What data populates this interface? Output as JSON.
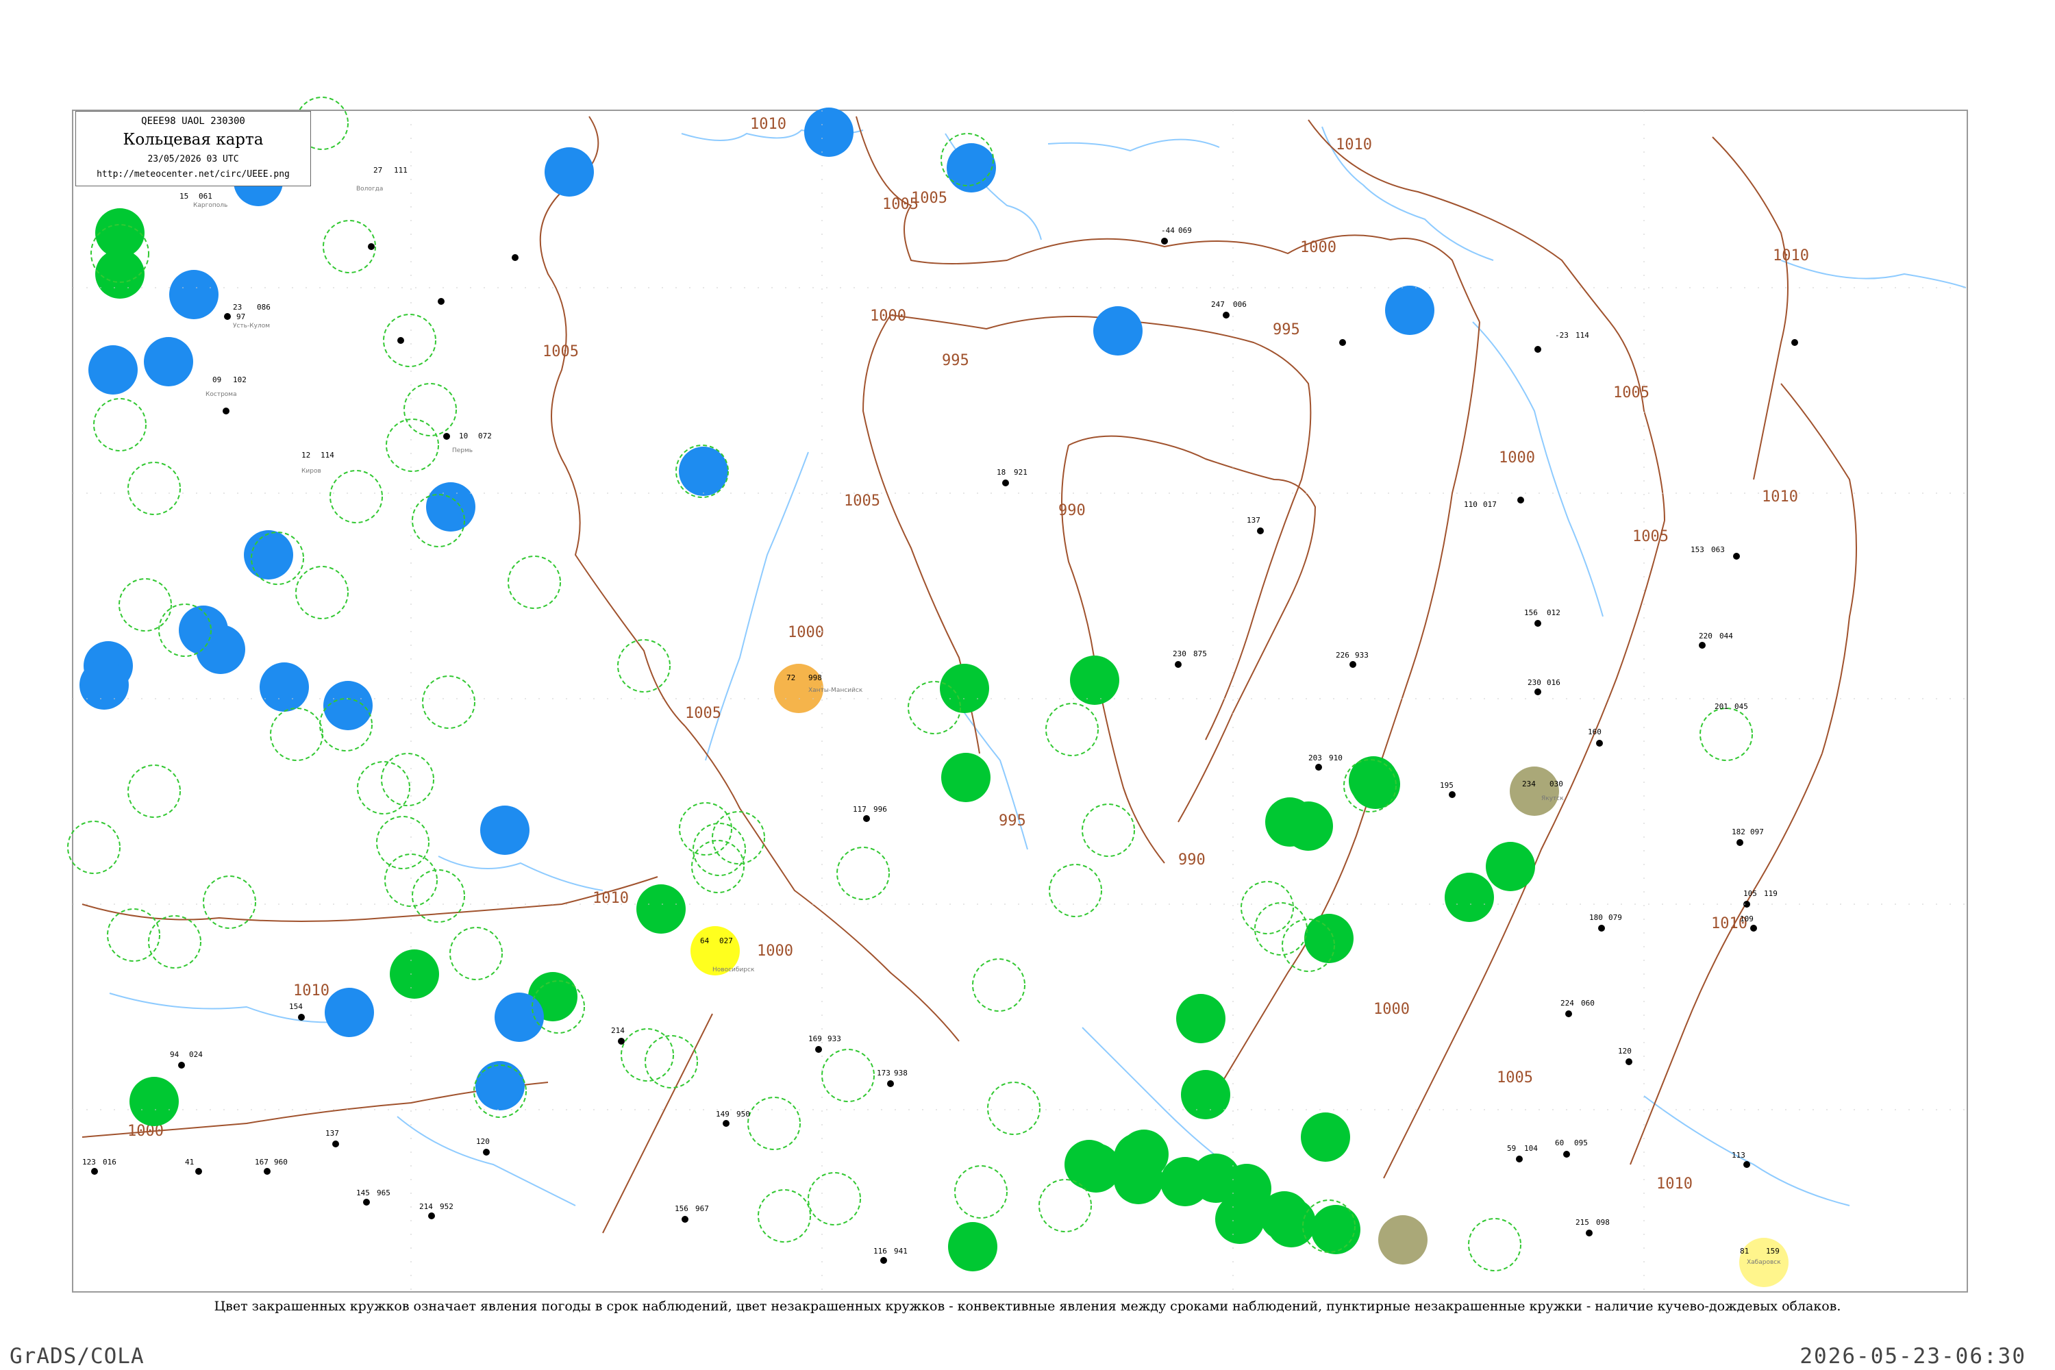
{
  "header": {
    "code": "QEEE98 UAOL 230300",
    "title": "Кольцевая карта",
    "datetime": "23/05/2026 03 UTC",
    "url": "http://meteocenter.net/circ/UEEE.png"
  },
  "caption": "Цвет закрашенных кружков означает явления погоды в срок наблюдений, цвет незакрашенных кружков - конвективные явления между сроками наблюдений, пунктирные незакрашенные кружки - наличие кучево-дождевых облаков.",
  "footer": {
    "software": "GrADS/COLA",
    "generated": "2026-05-23-06:30"
  },
  "colors": {
    "frame": "#9a9a9a",
    "isobar": "#a0522d",
    "isobar_label": "#a0522d",
    "water": "#8ecbff",
    "rain": "#00c832",
    "snow": "#1e8cf0",
    "fog_haze": "#f5b44b",
    "lightning": "#ffff1e",
    "dust": "#aaa878",
    "yellow_light": "#fff58c",
    "cb_dashed": "#32c832",
    "station_text": "#000000"
  },
  "isobar_labels": [
    "1010",
    "1005",
    "1000",
    "995",
    "990",
    "995",
    "1000",
    "1005",
    "1010",
    "1010",
    "1005",
    "1000",
    "995",
    "990",
    "1000",
    "1005",
    "1010",
    "1000",
    "1005",
    "1010",
    "1010",
    "1005",
    "1010",
    "1000",
    "1000",
    "1005",
    "1010",
    "1005"
  ],
  "stations": [
    {
      "name": "Усть-Кулом",
      "t": "23",
      "p": "086",
      "precip_type": "snow"
    },
    {
      "name": "Каргополь",
      "t": "15",
      "p": "061",
      "precip_type": "snow"
    },
    {
      "name": "Вологда",
      "t": "27",
      "p": "111",
      "precip_type": "none"
    },
    {
      "name": "Кострома",
      "t": "09",
      "p": "102",
      "precip_type": "rain"
    },
    {
      "name": "Киров",
      "t": "12",
      "p": "114",
      "precip_type": "none"
    },
    {
      "name": "Пермь",
      "t": "10",
      "p": "072",
      "precip_type": "none"
    },
    {
      "name": "Хабаровск",
      "t": "81",
      "p": "159",
      "precip_type": "lightning"
    },
    {
      "name": "Якутск",
      "t": "234",
      "p": "030",
      "precip_type": "dust"
    },
    {
      "name": "Новосибирск",
      "t": "64",
      "p": "027",
      "precip_type": "lightning"
    },
    {
      "name": "Ханты-Мансийск",
      "t": "72",
      "p": "998",
      "precip_type": "fog"
    }
  ]
}
